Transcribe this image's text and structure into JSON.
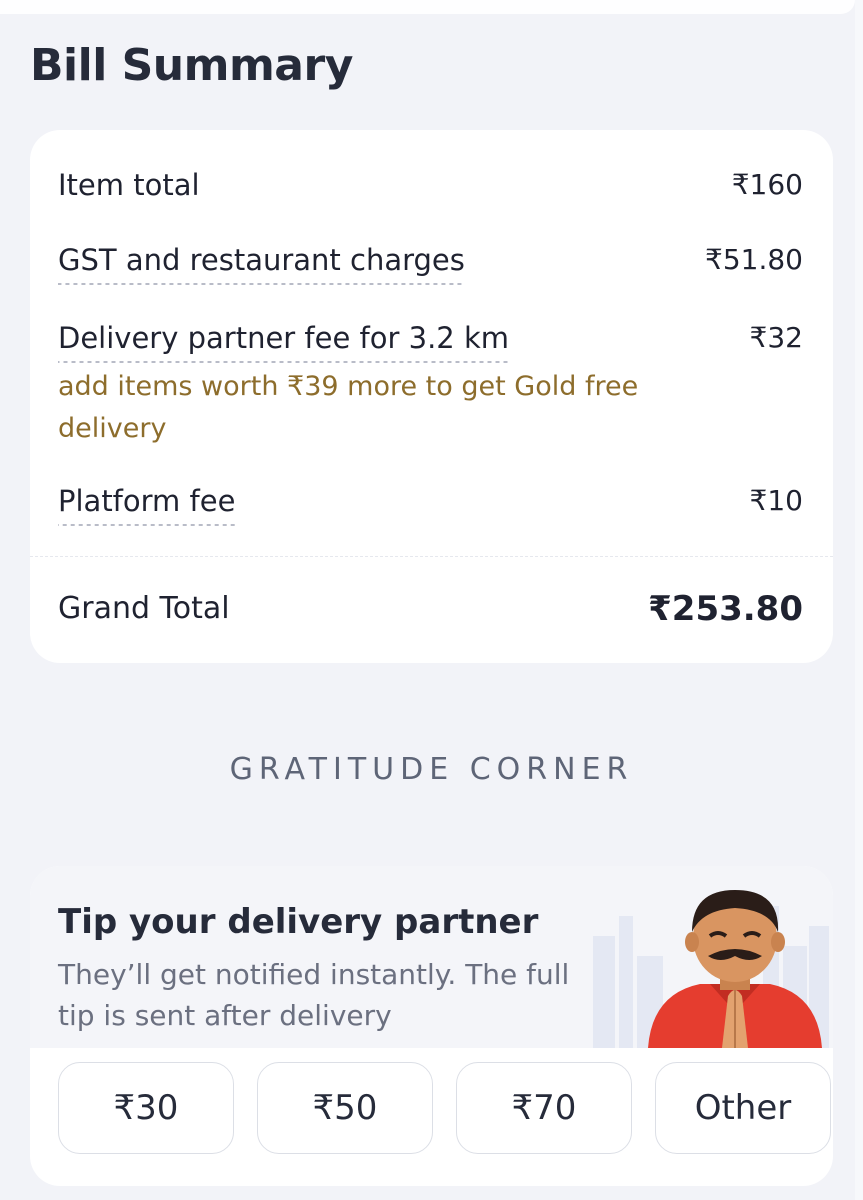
{
  "bill_summary": {
    "title": "Bill Summary",
    "item_total": {
      "label": "Item total",
      "amount": "₹160"
    },
    "gst": {
      "label": "GST and restaurant charges",
      "amount": "₹51.80"
    },
    "delivery": {
      "label": "Delivery partner fee for 3.2 km",
      "amount": "₹32",
      "note": "add items worth ₹39 more to get Gold free delivery"
    },
    "platform": {
      "label": "Platform fee",
      "amount": "₹10"
    },
    "grand_total": {
      "label": "Grand Total",
      "amount": "₹253.80"
    }
  },
  "gratitude": {
    "heading": "GRATITUDE CORNER"
  },
  "tip": {
    "title": "Tip your delivery partner",
    "subtitle": "They’ll get notified instantly. The full tip is sent after delivery",
    "options": [
      "₹30",
      "₹50",
      "₹70",
      "Other"
    ]
  },
  "colors": {
    "background": "#f2f3f8",
    "card": "#ffffff",
    "note": "#8d6d2c",
    "text": "#1f2230"
  },
  "icons": {
    "avatar": "delivery-partner-namaste-illustration"
  }
}
